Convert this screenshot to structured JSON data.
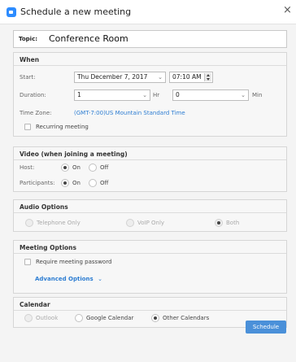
{
  "window": {
    "title": "Schedule a new meeting",
    "close_glyph": "×"
  },
  "topic": {
    "label": "Topic:",
    "value": "Conference Room"
  },
  "when": {
    "title": "When",
    "start_label": "Start:",
    "start_date": "Thu  December  7, 2017",
    "start_time": "07:10 AM",
    "duration_label": "Duration:",
    "duration_hours": "1",
    "hours_unit": "Hr",
    "duration_minutes": "0",
    "minutes_unit": "Min",
    "timezone_label": "Time Zone:",
    "timezone_value": "(GMT-7:00)US Mountain Standard Time",
    "recurring_label": "Recurring meeting",
    "recurring_checked": false
  },
  "video": {
    "title": "Video (when joining a meeting)",
    "host_label": "Host:",
    "participants_label": "Participants:",
    "on_label": "On",
    "off_label": "Off",
    "host_on": true,
    "participants_on": true
  },
  "audio": {
    "title": "Audio Options",
    "options": [
      "Telephone Only",
      "VoIP Only",
      "Both"
    ],
    "selected": "Both"
  },
  "meeting_options": {
    "title": "Meeting Options",
    "require_password_label": "Require meeting password",
    "require_password_checked": false,
    "advanced_label": "Advanced Options",
    "advanced_chevron": "⌄"
  },
  "calendar": {
    "title": "Calendar",
    "options": [
      "Outlook",
      "Google Calendar",
      "Other Calendars"
    ],
    "selected": "Other Calendars"
  },
  "actions": {
    "schedule_label": "Schedule"
  },
  "colors": {
    "accent": "#2d8cff",
    "link": "#2d7dd2",
    "button": "#4a90d9"
  }
}
